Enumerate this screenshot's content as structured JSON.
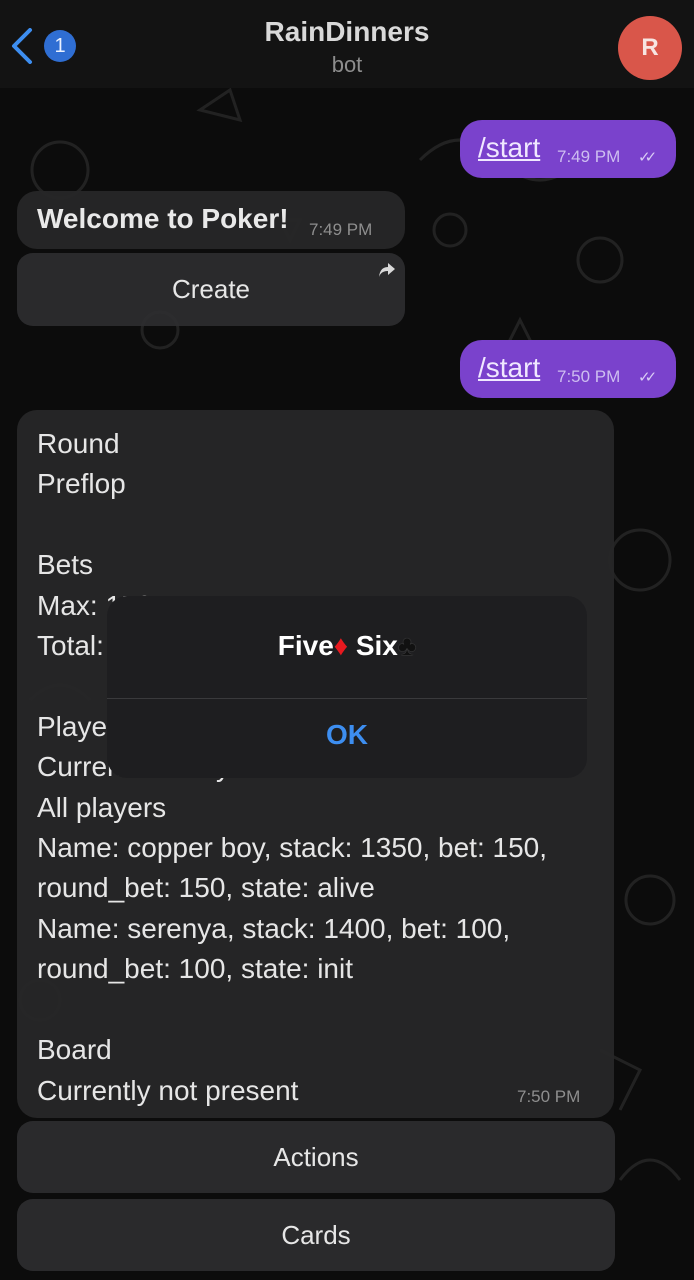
{
  "header": {
    "unread_count": "1",
    "title": "RainDinners",
    "subtitle": "bot",
    "avatar_letter": "R"
  },
  "messages": {
    "outgoing_1": {
      "text": "/start",
      "time": "7:49 PM",
      "ticks": "✓✓"
    },
    "welcome": {
      "text": "Welcome to Poker!",
      "time": "7:49 PM"
    },
    "create_button": "Create",
    "outgoing_2": {
      "text": "/start",
      "time": "7:50 PM",
      "ticks": "✓✓"
    },
    "status": {
      "body": "Round\nPreflop\n\nBets\nMax: 150\nTotal: 250\n\nPlayers\nCurrent: serenya\nAll players\nName: copper boy, stack: 1350, bet: 150,\nround_bet: 150, state: alive\nName: serenya, stack: 1400, bet: 100,\nround_bet: 100, state: init\n\nBoard\nCurrently not present",
      "time": "7:50 PM"
    }
  },
  "keyboard": {
    "actions": "Actions",
    "cards": "Cards"
  },
  "alert": {
    "card1": "Five",
    "suit1": "♦",
    "card2": "Six",
    "suit2": "♣",
    "ok": "OK"
  },
  "colors": {
    "accent_blue": "#3d8ef0",
    "outgoing_bubble": "#7a42cc",
    "avatar": "#d9564a"
  }
}
